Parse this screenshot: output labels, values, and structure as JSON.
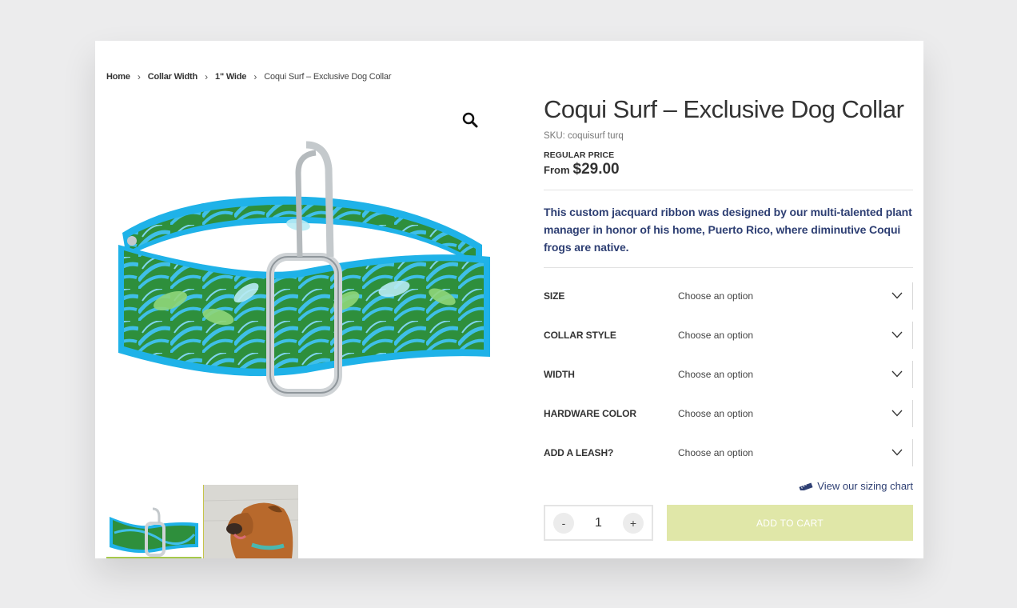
{
  "breadcrumb": {
    "items": [
      "Home",
      "Collar Width",
      "1\" Wide"
    ],
    "current": "Coqui Surf – Exclusive Dog Collar"
  },
  "product": {
    "title": "Coqui Surf – Exclusive Dog Collar",
    "sku": "SKU: coquisurf turq",
    "price_label": "REGULAR PRICE",
    "price_prefix": "From",
    "price": "$29.00",
    "description": "This custom jacquard ribbon was designed by our multi-talented plant manager in honor of his home, Puerto Rico, where diminutive Coqui frogs are native."
  },
  "options": [
    {
      "label": "SIZE",
      "value": "Choose an option"
    },
    {
      "label": "COLLAR STYLE",
      "value": "Choose an option"
    },
    {
      "label": "WIDTH",
      "value": "Choose an option"
    },
    {
      "label": "HARDWARE COLOR",
      "value": "Choose an option"
    },
    {
      "label": "ADD A LEASH?",
      "value": "Choose an option"
    }
  ],
  "sizing_link": "View our sizing chart",
  "cart": {
    "minus": "-",
    "quantity": "1",
    "plus": "+",
    "add_label": "ADD TO CART"
  },
  "colors": {
    "accent_navy": "#2e3f73",
    "add_to_cart_bg": "#e0e7a8",
    "collar_turquoise": "#1fb2e8",
    "collar_green": "#2e8f3c"
  },
  "icons": [
    "search-icon",
    "chevron-down-icon",
    "ruler-icon"
  ]
}
